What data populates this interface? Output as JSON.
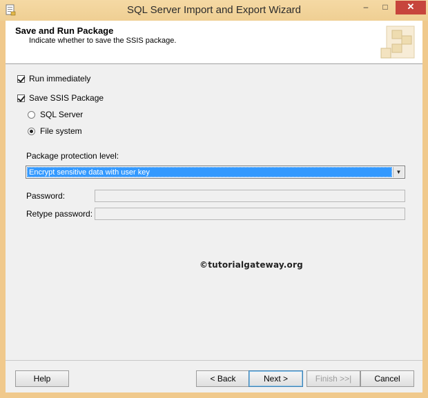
{
  "window": {
    "title": "SQL Server Import and Export Wizard",
    "controls": {
      "minimize": "–",
      "maximize": "□",
      "close": "✕"
    }
  },
  "header": {
    "title": "Save and Run Package",
    "subtitle": "Indicate whether to save the SSIS package."
  },
  "options": {
    "run_immediately": {
      "label": "Run immediately",
      "checked": true
    },
    "save_ssis_package": {
      "label": "Save SSIS Package",
      "checked": true
    },
    "save_location": [
      {
        "label": "SQL Server",
        "selected": false
      },
      {
        "label": "File system",
        "selected": true
      }
    ]
  },
  "protection": {
    "label": "Package protection level:",
    "selected_value": "Encrypt sensitive data with user key"
  },
  "fields": {
    "password_label": "Password:",
    "password_value": "",
    "retype_label": "Retype password:",
    "retype_value": ""
  },
  "watermark": "©tutorialgateway.org",
  "buttons": {
    "help": "Help",
    "back": "< Back",
    "next": "Next >",
    "finish": "Finish >>|",
    "cancel": "Cancel"
  },
  "colors": {
    "titlebar": "#f0c98c",
    "selection": "#3399ff",
    "close_button": "#c7453c"
  }
}
